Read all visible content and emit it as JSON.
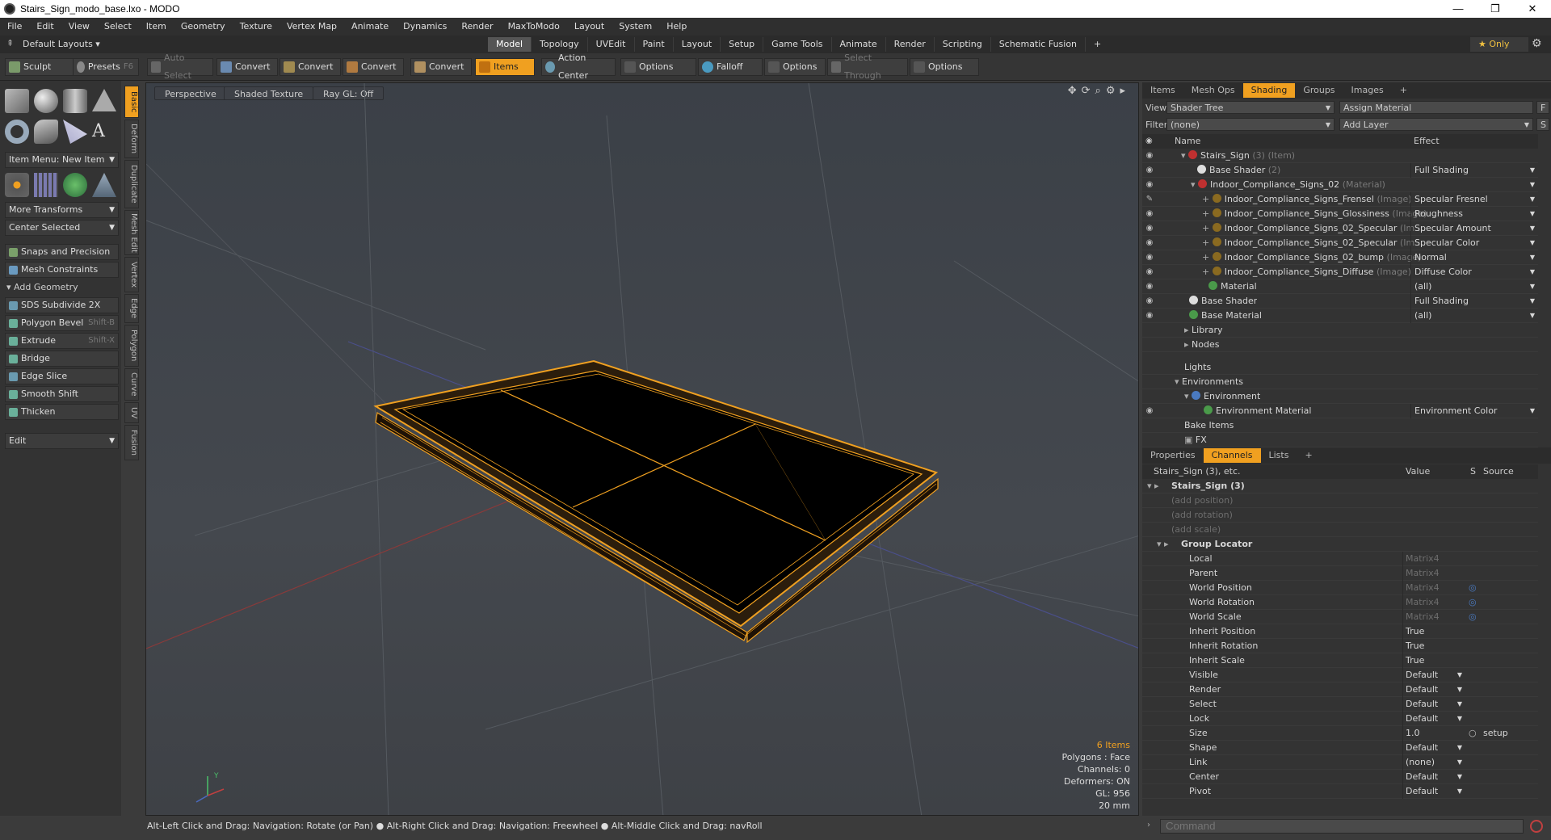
{
  "title": "Stairs_Sign_modo_base.lxo - MODO",
  "window_controls": [
    "—",
    "❐",
    "✕"
  ],
  "menus": [
    "File",
    "Edit",
    "View",
    "Select",
    "Item",
    "Geometry",
    "Texture",
    "Vertex Map",
    "Animate",
    "Dynamics",
    "Render",
    "MaxToModo",
    "Layout",
    "System",
    "Help"
  ],
  "layout_selector": "Default Layouts ▾",
  "layout_tabs": [
    "Model",
    "Topology",
    "UVEdit",
    "Paint",
    "Layout",
    "Setup",
    "Game Tools",
    "Animate",
    "Render",
    "Scripting",
    "Schematic Fusion",
    "+"
  ],
  "active_layout_tab": "Model",
  "only_label": "★ Only",
  "toolbar": {
    "sculpt": "Sculpt",
    "presets": "Presets",
    "presets_key": "F6",
    "auto_select": "Auto Select",
    "convert1": "Convert",
    "convert2": "Convert",
    "convert3": "Convert",
    "convert4": "Convert",
    "items": "Items",
    "action_center": "Action Center",
    "options1": "Options",
    "falloff": "Falloff",
    "options2": "Options",
    "select_through": "Select Through",
    "options3": "Options"
  },
  "left": {
    "item_menu": "Item Menu: New Item",
    "more_transforms": "More Transforms",
    "center_selected": "Center Selected",
    "snaps": "Snaps and Precision",
    "mesh_constraints": "Mesh Constraints",
    "add_geometry": "Add Geometry",
    "tools": [
      {
        "label": "SDS Subdivide 2X",
        "key": ""
      },
      {
        "label": "Polygon Bevel",
        "key": "Shift-B"
      },
      {
        "label": "Extrude",
        "key": "Shift-X"
      },
      {
        "label": "Bridge",
        "key": ""
      },
      {
        "label": "Edge Slice",
        "key": ""
      },
      {
        "label": "Smooth Shift",
        "key": ""
      },
      {
        "label": "Thicken",
        "key": ""
      }
    ],
    "edit": "Edit",
    "vtabs": [
      "Basic",
      "Deform",
      "Duplicate",
      "Mesh Edit",
      "Vertex",
      "Edge",
      "Polygon",
      "Curve",
      "UV",
      "Fusion"
    ]
  },
  "viewport": {
    "view": "Perspective",
    "shading": "Shaded Texture",
    "raygl": "Ray GL: Off",
    "stats": {
      "items": "6 Items",
      "polygons": "Polygons : Face",
      "channels": "Channels: 0",
      "deformers": "Deformers: ON",
      "gl": "GL: 956",
      "scale": "20 mm"
    }
  },
  "shading_panel": {
    "tabs": [
      "Items",
      "Mesh Ops",
      "Shading",
      "Groups",
      "Images",
      "+"
    ],
    "active_tab": "Shading",
    "view_label": "View",
    "view_value": "Shader Tree",
    "assign": "Assign Material",
    "f_btn": "F",
    "filter_label": "Filter",
    "filter_value": "(none)",
    "add_layer": "Add Layer",
    "s_btn": "S",
    "col_name": "Name",
    "col_effect": "Effect",
    "rows": [
      {
        "name": "Stairs_Sign",
        "type": "(3) (Item)",
        "effect": "",
        "dot": "#c03030"
      },
      {
        "name": "Base Shader",
        "type": "(2)",
        "effect": "Full Shading",
        "dot": "#dddddd"
      },
      {
        "name": "Indoor_Compliance_Signs_02",
        "type": "(Material)",
        "effect": "",
        "dot": "#c03030"
      },
      {
        "name": "Indoor_Compliance_Signs_Frensel",
        "type": "(Image)",
        "effect": "Specular Fresnel",
        "dot": "#8a6a20"
      },
      {
        "name": "Indoor_Compliance_Signs_Glossiness",
        "type": "(Image)",
        "effect": "Roughness",
        "dot": "#8a6a20"
      },
      {
        "name": "Indoor_Compliance_Signs_02_Specular",
        "type": "(Im ...",
        "effect": "Specular Amount",
        "dot": "#8a6a20"
      },
      {
        "name": "Indoor_Compliance_Signs_02_Specular",
        "type": "(Im ...",
        "effect": "Specular Color",
        "dot": "#8a6a20"
      },
      {
        "name": "Indoor_Compliance_Signs_02_bump",
        "type": "(Image)",
        "effect": "Normal",
        "dot": "#8a6a20"
      },
      {
        "name": "Indoor_Compliance_Signs_Diffuse",
        "type": "(Image)",
        "effect": "Diffuse Color",
        "dot": "#8a6a20"
      },
      {
        "name": "Material",
        "type": "",
        "effect": "(all)",
        "dot": "#4a9a4a"
      },
      {
        "name": "Base Shader",
        "type": "",
        "effect": "Full Shading",
        "dot": "#dddddd"
      },
      {
        "name": "Base Material",
        "type": "",
        "effect": "(all)",
        "dot": "#4a9a4a"
      },
      {
        "name": "Library",
        "type": "",
        "effect": "",
        "dot": ""
      },
      {
        "name": "Nodes",
        "type": "",
        "effect": "",
        "dot": ""
      },
      {
        "name": "Lights",
        "type": "",
        "effect": "",
        "dot": ""
      },
      {
        "name": "Environments",
        "type": "",
        "effect": "",
        "dot": ""
      },
      {
        "name": "Environment",
        "type": "",
        "effect": "",
        "dot": "#4a7ac0"
      },
      {
        "name": "Environment Material",
        "type": "",
        "effect": "Environment Color",
        "dot": "#4a9a4a"
      },
      {
        "name": "Bake Items",
        "type": "",
        "effect": "",
        "dot": ""
      },
      {
        "name": "FX",
        "type": "",
        "effect": "",
        "dot": ""
      }
    ]
  },
  "channels_panel": {
    "tabs": [
      "Properties",
      "Channels",
      "Lists",
      "+"
    ],
    "active_tab": "Channels",
    "col_name": "Stairs_Sign (3), etc.",
    "col_value": "Value",
    "col_s": "S",
    "col_source": "Source",
    "rows": [
      {
        "name": "Stairs_Sign (3)",
        "value": "",
        "source": ""
      },
      {
        "name": "(add position)",
        "value": "",
        "source": ""
      },
      {
        "name": "(add rotation)",
        "value": "",
        "source": ""
      },
      {
        "name": "(add scale)",
        "value": "",
        "source": ""
      },
      {
        "name": "Group Locator",
        "value": "",
        "source": ""
      },
      {
        "name": "Local",
        "value": "Matrix4",
        "source": ""
      },
      {
        "name": "Parent",
        "value": "Matrix4",
        "source": ""
      },
      {
        "name": "World Position",
        "value": "Matrix4",
        "source": ""
      },
      {
        "name": "World Rotation",
        "value": "Matrix4",
        "source": ""
      },
      {
        "name": "World Scale",
        "value": "Matrix4",
        "source": ""
      },
      {
        "name": "Inherit Position",
        "value": "True",
        "source": ""
      },
      {
        "name": "Inherit Rotation",
        "value": "True",
        "source": ""
      },
      {
        "name": "Inherit Scale",
        "value": "True",
        "source": ""
      },
      {
        "name": "Visible",
        "value": "Default",
        "source": ""
      },
      {
        "name": "Render",
        "value": "Default",
        "source": ""
      },
      {
        "name": "Select",
        "value": "Default",
        "source": ""
      },
      {
        "name": "Lock",
        "value": "Default",
        "source": ""
      },
      {
        "name": "Size",
        "value": "1.0",
        "source": "setup"
      },
      {
        "name": "Shape",
        "value": "Default",
        "source": ""
      },
      {
        "name": "Link",
        "value": "(none)",
        "source": ""
      },
      {
        "name": "Center",
        "value": "Default",
        "source": ""
      },
      {
        "name": "Pivot",
        "value": "Default",
        "source": ""
      }
    ]
  },
  "status": "Alt-Left Click and Drag: Navigation: Rotate (or Pan) ● Alt-Right Click and Drag: Navigation: Freewheel ● Alt-Middle Click and Drag: navRoll",
  "command_placeholder": "Command"
}
